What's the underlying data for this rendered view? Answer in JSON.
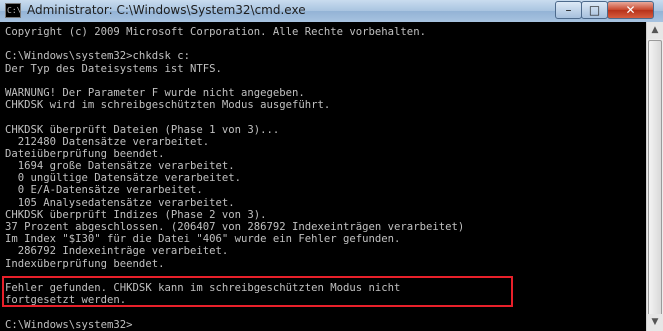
{
  "window": {
    "title": "Administrator: C:\\Windows\\System32\\cmd.exe",
    "icon_text": "C:\\",
    "controls": {
      "minimize": "–",
      "maximize": "□",
      "close": "✕"
    }
  },
  "console": {
    "lines": [
      "Copyright (c) 2009 Microsoft Corporation. Alle Rechte vorbehalten.",
      "",
      "C:\\Windows\\system32>chkdsk c:",
      "Der Typ des Dateisystems ist NTFS.",
      "",
      "WARNUNG! Der Parameter F wurde nicht angegeben.",
      "CHKDSK wird im schreibgeschützten Modus ausgeführt.",
      "",
      "CHKDSK überprüft Dateien (Phase 1 von 3)...",
      "  212480 Datensätze verarbeitet.",
      "Dateiüberprüfung beendet.",
      "  1694 große Datensätze verarbeitet.",
      "  0 ungültige Datensätze verarbeitet.",
      "  0 E/A-Datensätze verarbeitet.",
      "  105 Analysedatensätze verarbeitet.",
      "CHKDSK überprüft Indizes (Phase 2 von 3).",
      "37 Prozent abgeschlossen. (206407 von 286792 Indexeinträgen verarbeitet)",
      "Im Index \"$I30\" für die Datei \"406\" wurde ein Fehler gefunden.",
      "  286792 Indexeinträge verarbeitet.",
      "Indexüberprüfung beendet.",
      "",
      "Fehler gefunden. CHKDSK kann im schreibgeschützten Modus nicht",
      "fortgesetzt werden.",
      "",
      "C:\\Windows\\system32>"
    ]
  },
  "scrollbar": {
    "up_arrow": "▲",
    "down_arrow": "▼"
  },
  "colors": {
    "console_bg": "#000000",
    "console_text": "#c0c0c0",
    "highlight": "#e8202a"
  }
}
